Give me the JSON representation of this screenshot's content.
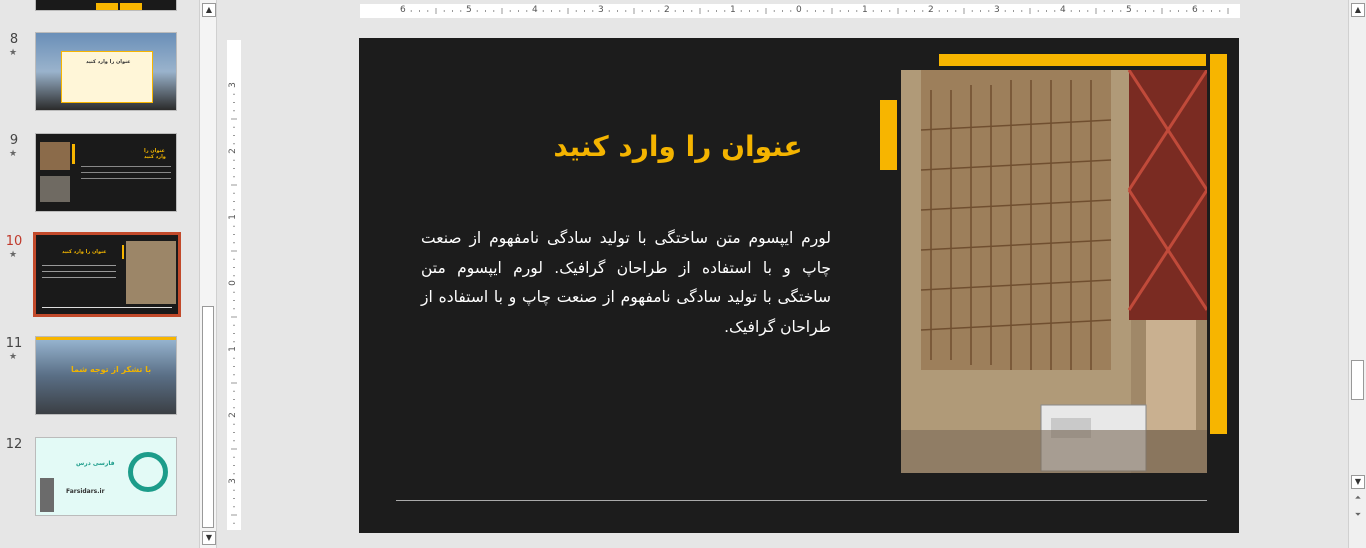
{
  "thumbnails": [
    {
      "num": "8",
      "star": "★",
      "title": "عنوان را وارد کنید"
    },
    {
      "num": "9",
      "star": "★",
      "title": "عنوان را وارد کنید"
    },
    {
      "num": "10",
      "star": "★",
      "title": "عنوان را وارد کنید"
    },
    {
      "num": "11",
      "star": "★",
      "title": "با تشکر از توجه شما"
    },
    {
      "num": "12",
      "star": "",
      "title": "Farsidars.ir",
      "brand": "فارسی درس"
    }
  ],
  "ruler": {
    "h_ticks": [
      "6",
      "5",
      "4",
      "3",
      "2",
      "1",
      "0",
      "1",
      "2",
      "3",
      "4",
      "5",
      "6"
    ],
    "v_ticks": [
      "3",
      "2",
      "1",
      "0",
      "1",
      "2",
      "3"
    ]
  },
  "slide": {
    "title": "عنوان را وارد کنید",
    "body": "لورم ایپسوم متن ساختگی با تولید سادگی نامفهوم از صنعت چاپ و با استفاده از طراحان گرافیک. لورم ایپسوم متن ساختگی با تولید سادگی نامفهوم از صنعت چاپ و با استفاده از طراحان گرافیک."
  },
  "colors": {
    "accent": "#f7b500",
    "slide_bg": "#1c1c1c",
    "selected_border": "#c24a2b"
  },
  "icons": {
    "up": "▲",
    "down": "▼",
    "prev_slide": "⏶",
    "next_slide": "⏷"
  }
}
